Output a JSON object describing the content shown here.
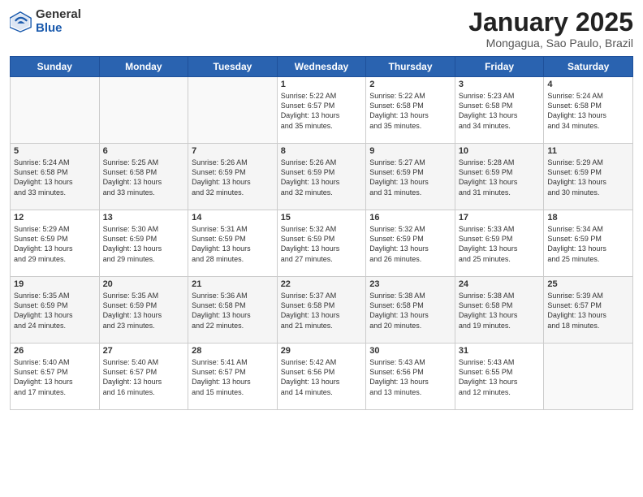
{
  "header": {
    "logo_general": "General",
    "logo_blue": "Blue",
    "month_title": "January 2025",
    "location": "Mongagua, Sao Paulo, Brazil"
  },
  "days_of_week": [
    "Sunday",
    "Monday",
    "Tuesday",
    "Wednesday",
    "Thursday",
    "Friday",
    "Saturday"
  ],
  "weeks": [
    [
      {
        "day": "",
        "info": ""
      },
      {
        "day": "",
        "info": ""
      },
      {
        "day": "",
        "info": ""
      },
      {
        "day": "1",
        "info": "Sunrise: 5:22 AM\nSunset: 6:57 PM\nDaylight: 13 hours\nand 35 minutes."
      },
      {
        "day": "2",
        "info": "Sunrise: 5:22 AM\nSunset: 6:58 PM\nDaylight: 13 hours\nand 35 minutes."
      },
      {
        "day": "3",
        "info": "Sunrise: 5:23 AM\nSunset: 6:58 PM\nDaylight: 13 hours\nand 34 minutes."
      },
      {
        "day": "4",
        "info": "Sunrise: 5:24 AM\nSunset: 6:58 PM\nDaylight: 13 hours\nand 34 minutes."
      }
    ],
    [
      {
        "day": "5",
        "info": "Sunrise: 5:24 AM\nSunset: 6:58 PM\nDaylight: 13 hours\nand 33 minutes."
      },
      {
        "day": "6",
        "info": "Sunrise: 5:25 AM\nSunset: 6:58 PM\nDaylight: 13 hours\nand 33 minutes."
      },
      {
        "day": "7",
        "info": "Sunrise: 5:26 AM\nSunset: 6:59 PM\nDaylight: 13 hours\nand 32 minutes."
      },
      {
        "day": "8",
        "info": "Sunrise: 5:26 AM\nSunset: 6:59 PM\nDaylight: 13 hours\nand 32 minutes."
      },
      {
        "day": "9",
        "info": "Sunrise: 5:27 AM\nSunset: 6:59 PM\nDaylight: 13 hours\nand 31 minutes."
      },
      {
        "day": "10",
        "info": "Sunrise: 5:28 AM\nSunset: 6:59 PM\nDaylight: 13 hours\nand 31 minutes."
      },
      {
        "day": "11",
        "info": "Sunrise: 5:29 AM\nSunset: 6:59 PM\nDaylight: 13 hours\nand 30 minutes."
      }
    ],
    [
      {
        "day": "12",
        "info": "Sunrise: 5:29 AM\nSunset: 6:59 PM\nDaylight: 13 hours\nand 29 minutes."
      },
      {
        "day": "13",
        "info": "Sunrise: 5:30 AM\nSunset: 6:59 PM\nDaylight: 13 hours\nand 29 minutes."
      },
      {
        "day": "14",
        "info": "Sunrise: 5:31 AM\nSunset: 6:59 PM\nDaylight: 13 hours\nand 28 minutes."
      },
      {
        "day": "15",
        "info": "Sunrise: 5:32 AM\nSunset: 6:59 PM\nDaylight: 13 hours\nand 27 minutes."
      },
      {
        "day": "16",
        "info": "Sunrise: 5:32 AM\nSunset: 6:59 PM\nDaylight: 13 hours\nand 26 minutes."
      },
      {
        "day": "17",
        "info": "Sunrise: 5:33 AM\nSunset: 6:59 PM\nDaylight: 13 hours\nand 25 minutes."
      },
      {
        "day": "18",
        "info": "Sunrise: 5:34 AM\nSunset: 6:59 PM\nDaylight: 13 hours\nand 25 minutes."
      }
    ],
    [
      {
        "day": "19",
        "info": "Sunrise: 5:35 AM\nSunset: 6:59 PM\nDaylight: 13 hours\nand 24 minutes."
      },
      {
        "day": "20",
        "info": "Sunrise: 5:35 AM\nSunset: 6:59 PM\nDaylight: 13 hours\nand 23 minutes."
      },
      {
        "day": "21",
        "info": "Sunrise: 5:36 AM\nSunset: 6:58 PM\nDaylight: 13 hours\nand 22 minutes."
      },
      {
        "day": "22",
        "info": "Sunrise: 5:37 AM\nSunset: 6:58 PM\nDaylight: 13 hours\nand 21 minutes."
      },
      {
        "day": "23",
        "info": "Sunrise: 5:38 AM\nSunset: 6:58 PM\nDaylight: 13 hours\nand 20 minutes."
      },
      {
        "day": "24",
        "info": "Sunrise: 5:38 AM\nSunset: 6:58 PM\nDaylight: 13 hours\nand 19 minutes."
      },
      {
        "day": "25",
        "info": "Sunrise: 5:39 AM\nSunset: 6:57 PM\nDaylight: 13 hours\nand 18 minutes."
      }
    ],
    [
      {
        "day": "26",
        "info": "Sunrise: 5:40 AM\nSunset: 6:57 PM\nDaylight: 13 hours\nand 17 minutes."
      },
      {
        "day": "27",
        "info": "Sunrise: 5:40 AM\nSunset: 6:57 PM\nDaylight: 13 hours\nand 16 minutes."
      },
      {
        "day": "28",
        "info": "Sunrise: 5:41 AM\nSunset: 6:57 PM\nDaylight: 13 hours\nand 15 minutes."
      },
      {
        "day": "29",
        "info": "Sunrise: 5:42 AM\nSunset: 6:56 PM\nDaylight: 13 hours\nand 14 minutes."
      },
      {
        "day": "30",
        "info": "Sunrise: 5:43 AM\nSunset: 6:56 PM\nDaylight: 13 hours\nand 13 minutes."
      },
      {
        "day": "31",
        "info": "Sunrise: 5:43 AM\nSunset: 6:55 PM\nDaylight: 13 hours\nand 12 minutes."
      },
      {
        "day": "",
        "info": ""
      }
    ]
  ]
}
